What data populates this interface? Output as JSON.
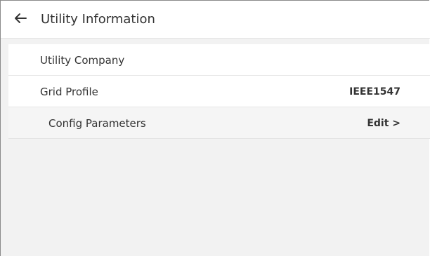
{
  "header": {
    "back_icon": "arrow-left-icon",
    "title": "Utility Information"
  },
  "rows": [
    {
      "label": "Utility Company",
      "value": ""
    },
    {
      "label": "Grid Profile",
      "value": "IEEE1547"
    },
    {
      "label": "Config Parameters",
      "value": "Edit >"
    }
  ],
  "colors": {
    "background": "#f2f2f2",
    "surface": "#ffffff",
    "text": "#333333"
  }
}
